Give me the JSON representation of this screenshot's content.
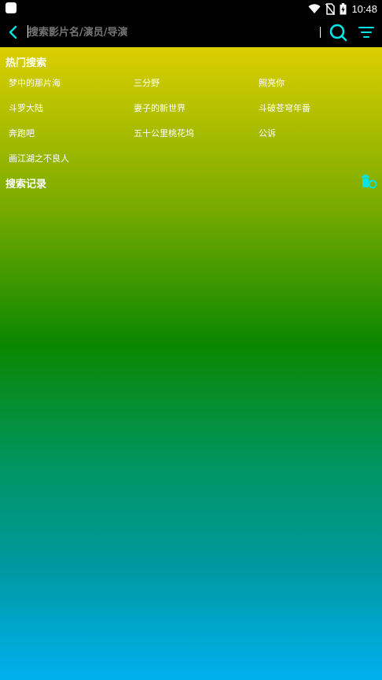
{
  "status_bar": {
    "time": "10:48",
    "icons": [
      "app-notification-icon",
      "wifi-icon",
      "no-sim-icon",
      "battery-charging-icon"
    ]
  },
  "toolbar": {
    "back_icon": "chevron-left-icon",
    "search_placeholder": "搜索影片名/演员/导演",
    "search_icon": "search-icon",
    "filter_icon": "filter-icon"
  },
  "hot_search": {
    "title": "热门搜索",
    "items": [
      "梦中的那片海",
      "三分野",
      "照亮你",
      "斗罗大陆",
      "妻子的新世界",
      "斗破苍穹年番",
      "奔跑吧",
      "五十公里桃花坞",
      "公诉",
      "画江湖之不良人"
    ]
  },
  "search_history": {
    "title": "搜索记录",
    "clear_icon": "trash-icon",
    "items": []
  },
  "colors": {
    "accent": "#00e5e5",
    "gradient_top": "#dccf00",
    "gradient_middle": "#0a8700",
    "gradient_bottom": "#00b0ee"
  }
}
